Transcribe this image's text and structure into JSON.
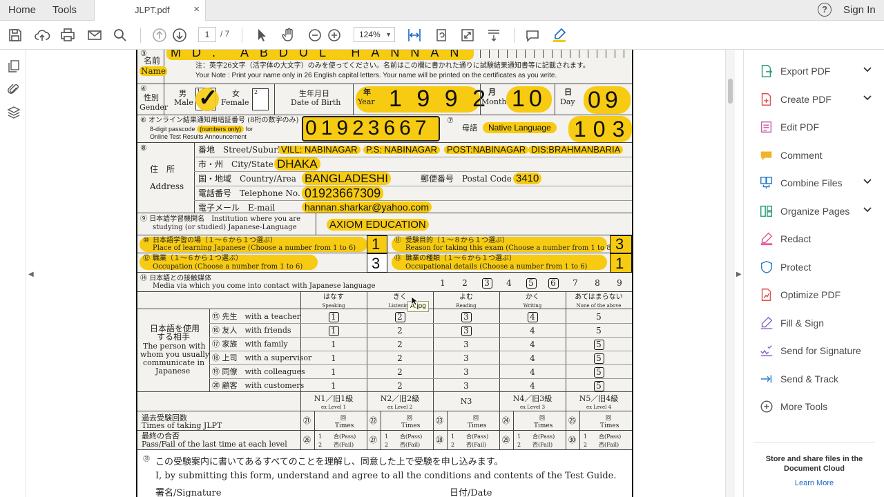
{
  "nav": {
    "home": "Home",
    "tools": "Tools",
    "doc_tab": "JLPT.pdf",
    "close": "×",
    "help": "?",
    "sign_in": "Sign In"
  },
  "toolbar": {
    "page_current": "1",
    "page_total": "/ 7",
    "zoom": "124%"
  },
  "tools_panel": {
    "items": [
      {
        "label": "Export PDF",
        "icon": "export-pdf-icon",
        "color": "#2d9b7c",
        "expand": true
      },
      {
        "label": "Create PDF",
        "icon": "create-pdf-icon",
        "color": "#d9534f",
        "expand": true
      },
      {
        "label": "Edit PDF",
        "icon": "edit-pdf-icon",
        "color": "#c85fa8",
        "expand": false
      },
      {
        "label": "Comment",
        "icon": "comment-icon",
        "color": "#f0b429",
        "expand": false
      },
      {
        "label": "Combine Files",
        "icon": "combine-files-icon",
        "color": "#2a7fc9",
        "expand": true
      },
      {
        "label": "Organize Pages",
        "icon": "organize-pages-icon",
        "color": "#2d9b7c",
        "expand": true
      },
      {
        "label": "Redact",
        "icon": "redact-icon",
        "color": "#e0589a",
        "expand": false
      },
      {
        "label": "Protect",
        "icon": "protect-icon",
        "color": "#2a7fc9",
        "expand": false
      },
      {
        "label": "Optimize PDF",
        "icon": "optimize-pdf-icon",
        "color": "#d9534f",
        "expand": false
      },
      {
        "label": "Fill & Sign",
        "icon": "fill-sign-icon",
        "color": "#8a68c8",
        "expand": false
      },
      {
        "label": "Send for Signature",
        "icon": "send-signature-icon",
        "color": "#8a68c8",
        "expand": false
      },
      {
        "label": "Send & Track",
        "icon": "send-track-icon",
        "color": "#2a7fc9",
        "expand": false
      },
      {
        "label": "More Tools",
        "icon": "more-tools-icon",
        "color": "#555555",
        "expand": false
      }
    ],
    "store_text": "Store and share files in the Document Cloud",
    "learn_more": "Learn More"
  },
  "form": {
    "name_value": "MD. ABDUL HANNAN",
    "name_no": "③",
    "name_jp": "名前",
    "name_en": "Name",
    "name_note_jp": "注：英字26文字（活字体の大文字）のみを使ってください。名前はこの欄に書かれた通りに試験結果通知書等に記載されます。",
    "name_note_en": "Your Note : Print your name only in 26 English capital letters. Your name will be printed on the certificates as you write.",
    "gender_no": "④",
    "gender_jp": "性別",
    "gender_en": "Gender",
    "male_jp": "男",
    "male_en": "Male",
    "male_box": "1",
    "check": "✓",
    "female_jp": "女",
    "female_en": "Female",
    "female_box": "2",
    "dob_jp": "生年月日",
    "dob_en": "Date of Birth",
    "year_jp": "年",
    "year_en": "Year",
    "year_val": [
      "1",
      "9",
      "9",
      "2"
    ],
    "month_jp": "月",
    "month_en": "Month",
    "month_val": "10",
    "day_jp": "日",
    "day_en": "Day",
    "day_val": "09",
    "pass_no": "⑥",
    "pass_jp": "オンライン結果通知用暗証番号 (8桁の数字のみ)",
    "pass_en1": "8-digit passcode",
    "pass_en_hl": "(numbers only)",
    "pass_en2": "for",
    "pass_en3": "Online Test Results Announcement",
    "passcode": [
      "0",
      "1",
      "9",
      "2",
      "3",
      "6",
      "6",
      "7"
    ],
    "lang_no": "⑦",
    "lang_jp": "母語",
    "lang_label": "Native Language",
    "lang_val": [
      "1",
      "0",
      "3"
    ],
    "addr_no": "⑧",
    "addr_jp": "住　所",
    "addr_en": "Address",
    "street_jp": "番地",
    "street_en": "Street/Suburb",
    "street_vals": [
      "VILL: NABINAGAR",
      "P.S: NABINAGAR",
      "POST:NABINAGAR",
      "DIS:BRAHMANBARIA"
    ],
    "city_jp": "市・州",
    "city_en": "City/State",
    "city_val": "DHAKA",
    "country_jp": "国・地域",
    "country_en": "Country/Area",
    "country_val": "BANGLADESHI",
    "postal_jp": "郵便番号",
    "postal_en": "Postal Code",
    "postal_val": "3410",
    "tel_jp": "電話番号",
    "tel_en": "Telephone No.",
    "tel_val": "01923667309",
    "email_jp": "電子メール",
    "email_en": "E-mail",
    "email_val": "hannan.sharkar@yahoo.com",
    "inst_no": "⑨",
    "inst_jp": "日本語学習機関名",
    "inst_en1": "Institution where you are",
    "inst_en2": "studying (or studied) Japanese-Language",
    "inst_val": "AXIOM EDUCATION",
    "q10_no": "⑩",
    "q10_jp": "日本語学習の場（１～６から１つ選ぶ）",
    "q10_en": "Place of learning Japanese (Choose a number from 1 to 6)",
    "q10_val": "1",
    "q11_no": "⑪",
    "q11_jp": "受験目的（１～８から１つ選ぶ）",
    "q11_en": "Reason for taking this exam (Choose a number from 1 to 8)",
    "q11_val": "3",
    "q12_no": "⑫",
    "q12_jp": "職業（１～６から１つ選ぶ）",
    "q12_en": "Occupation (Choose a number from 1 to 6)",
    "q12_val": "3",
    "q13_no": "⑬",
    "q13_jp": "職業の種類（１～６から１つ選ぶ）",
    "q13_en": "Occupational details (Choose a number from 1 to 6)",
    "q13_val": "1",
    "q14_no": "⑭",
    "q14_jp": "日本語との接触媒体",
    "q14_en": "Media via which you come into contact with Japanese language",
    "media_nums": [
      "1",
      "2",
      "3",
      "4",
      "5",
      "6",
      "7",
      "8",
      "9"
    ],
    "cols_jp": [
      "はなす",
      "きく",
      "よむ",
      "かく",
      "あてはまらない"
    ],
    "cols_en": [
      "Speaking",
      "Listening",
      "Reading",
      "Writing",
      "None of the above"
    ],
    "tooltip": "A.jpg",
    "partner_jp1": "日本語を使用",
    "partner_jp2": "する相手",
    "partner_en": [
      "The person with",
      "whom you usually",
      "communicate in",
      "Japanese"
    ],
    "rows": [
      {
        "no": "⑮",
        "jp": "先生",
        "en": "with a teacher",
        "vals": [
          "1",
          "2",
          "3",
          "4",
          "5"
        ]
      },
      {
        "no": "⑯",
        "jp": "友人",
        "en": "with friends",
        "vals": [
          "1",
          "2",
          "3",
          "4",
          "5"
        ]
      },
      {
        "no": "⑰",
        "jp": "家族",
        "en": "with family",
        "vals": [
          "1",
          "2",
          "3",
          "4",
          "5"
        ]
      },
      {
        "no": "⑱",
        "jp": "上司",
        "en": "with a supervisor",
        "vals": [
          "1",
          "2",
          "3",
          "4",
          "5"
        ]
      },
      {
        "no": "⑲",
        "jp": "同僚",
        "en": "with colleagues",
        "vals": [
          "1",
          "2",
          "3",
          "4",
          "5"
        ]
      },
      {
        "no": "⑳",
        "jp": "顧客",
        "en": "with customers",
        "vals": [
          "1",
          "2",
          "3",
          "4",
          "5"
        ]
      }
    ],
    "levels": [
      "N1／旧1級",
      "N2／旧2級",
      "N3",
      "N4／旧3級",
      "N5／旧4級"
    ],
    "levels_ex": [
      "ex Level 1",
      "ex Level 2",
      "",
      "ex Level 3",
      "ex Level 4"
    ],
    "times_jp": "過去受験回数",
    "times_en": "Times of taking JLPT",
    "times_nos": [
      "㉑",
      "㉒",
      "㉓",
      "㉔",
      "㉕"
    ],
    "kai": "回",
    "times_word": "Times",
    "pf_jp": "最終の合否",
    "pf_en": "Pass/Fail of the last time at each level",
    "pf_nos": [
      "㉖",
      "㉗",
      "㉘",
      "㉙",
      "㉚"
    ],
    "pass_lbl": "合(Pass)",
    "fail_lbl": "否(Fail)",
    "agree_jp": "この受験案内に書いてあるすべてのことを理解し、同意した上で受験を申し込みます。",
    "agree_en": "I, by submitting this form, understand and agree to all the conditions and contents of the Test Guide.",
    "sig_lbl": "署名/Signature",
    "date_lbl": "日付/Date"
  }
}
